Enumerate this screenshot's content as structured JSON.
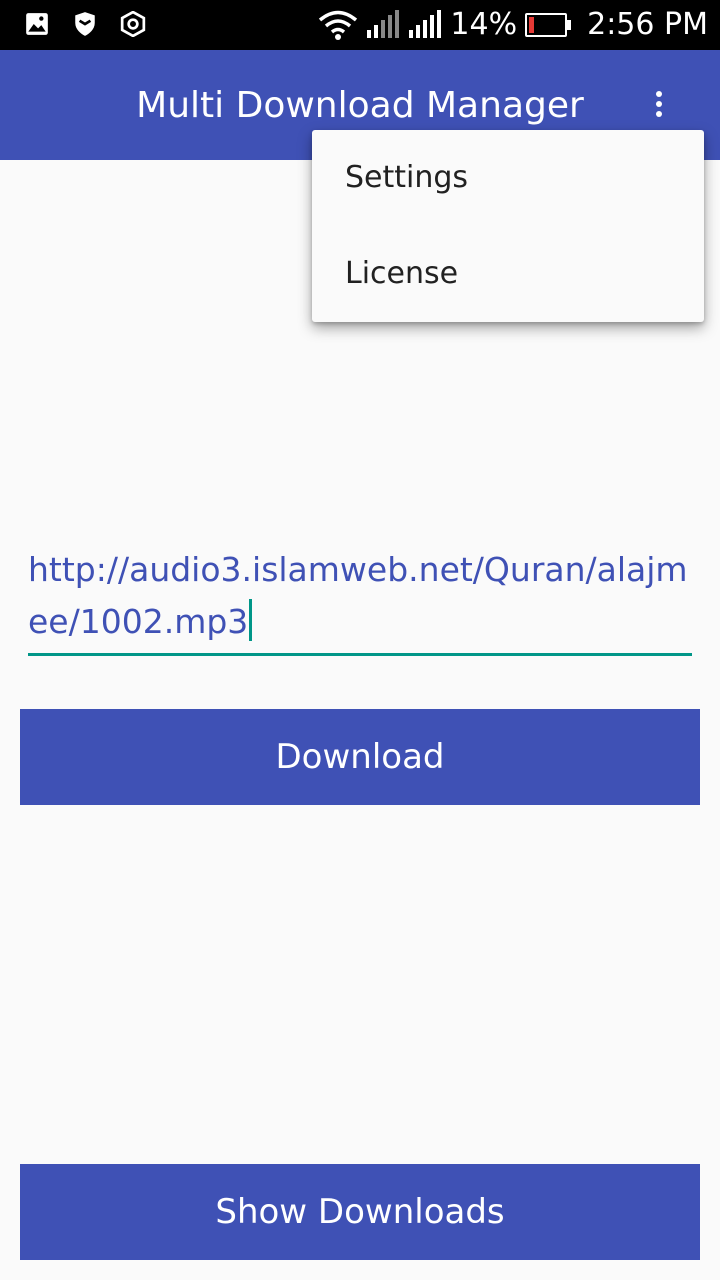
{
  "status_bar": {
    "icons_left": [
      "image-icon",
      "shield-icon",
      "target-icon"
    ],
    "battery_percent": "14%",
    "time": "2:56 PM"
  },
  "app_bar": {
    "title": "Multi Download Manager"
  },
  "overflow_menu": {
    "items": [
      {
        "label": "Settings"
      },
      {
        "label": "License"
      }
    ]
  },
  "url_input": {
    "value": "http://audio3.islamweb.net/Quran/alajmee/1002.mp3"
  },
  "buttons": {
    "download_label": "Download",
    "show_downloads_label": "Show Downloads"
  },
  "colors": {
    "primary": "#3f51b5",
    "accent": "#009688",
    "background": "#fafafa"
  }
}
